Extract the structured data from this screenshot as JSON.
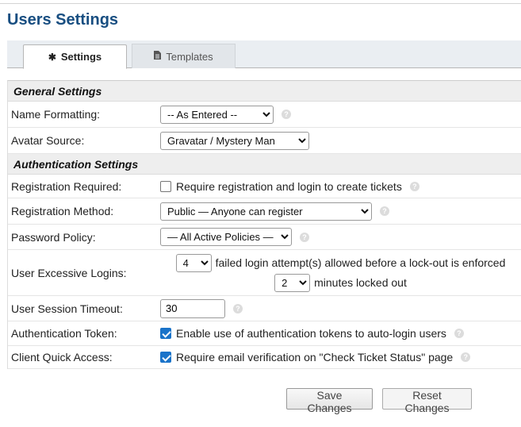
{
  "page": {
    "title": "Users Settings"
  },
  "tabs": [
    {
      "label": "Settings",
      "icon": "gear-icon",
      "active": true
    },
    {
      "label": "Templates",
      "icon": "file-icon",
      "active": false
    }
  ],
  "general": {
    "heading": "General Settings",
    "name_formatting": {
      "label": "Name Formatting:",
      "value": "-- As Entered --"
    },
    "avatar_source": {
      "label": "Avatar Source:",
      "value": "Gravatar / Mystery Man"
    }
  },
  "auth": {
    "heading": "Authentication Settings",
    "registration_required": {
      "label": "Registration Required:",
      "checkbox_text": "Require registration and login to create tickets",
      "checked": false
    },
    "registration_method": {
      "label": "Registration Method:",
      "value": "Public — Anyone can register"
    },
    "password_policy": {
      "label": "Password Policy:",
      "value": "— All Active Policies —"
    },
    "excessive_logins": {
      "label": "User Excessive Logins:",
      "attempts_value": "4",
      "attempts_text": "failed login attempt(s) allowed before a lock-out is enforced",
      "minutes_value": "2",
      "minutes_text": "minutes locked out"
    },
    "session_timeout": {
      "label": "User Session Timeout:",
      "value": "30"
    },
    "auth_token": {
      "label": "Authentication Token:",
      "checkbox_text": "Enable use of authentication tokens to auto-login users",
      "checked": true
    },
    "quick_access": {
      "label": "Client Quick Access:",
      "checkbox_text": "Require email verification on \"Check Ticket Status\" page",
      "checked": true
    }
  },
  "buttons": {
    "save": "Save Changes",
    "reset": "Reset Changes"
  },
  "colors": {
    "title": "#184e81",
    "checkbox": "#1a73c9",
    "section_bg": "#eeeeee"
  }
}
